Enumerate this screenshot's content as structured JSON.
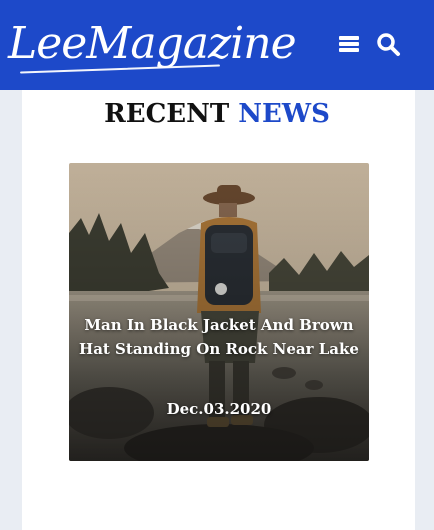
{
  "header": {
    "logo_text": "LeeMagazine",
    "menu_icon": "bars-icon",
    "search_icon": "search-icon",
    "background_color": "#1d49c9"
  },
  "section": {
    "heading_part1": "RECENT",
    "heading_part2": "NEWS",
    "accent_color": "#1d49c9"
  },
  "article": {
    "title": "Man In Black Jacket And Brown Hat Standing On Rock Near Lake",
    "date": "Dec.03.2020"
  }
}
